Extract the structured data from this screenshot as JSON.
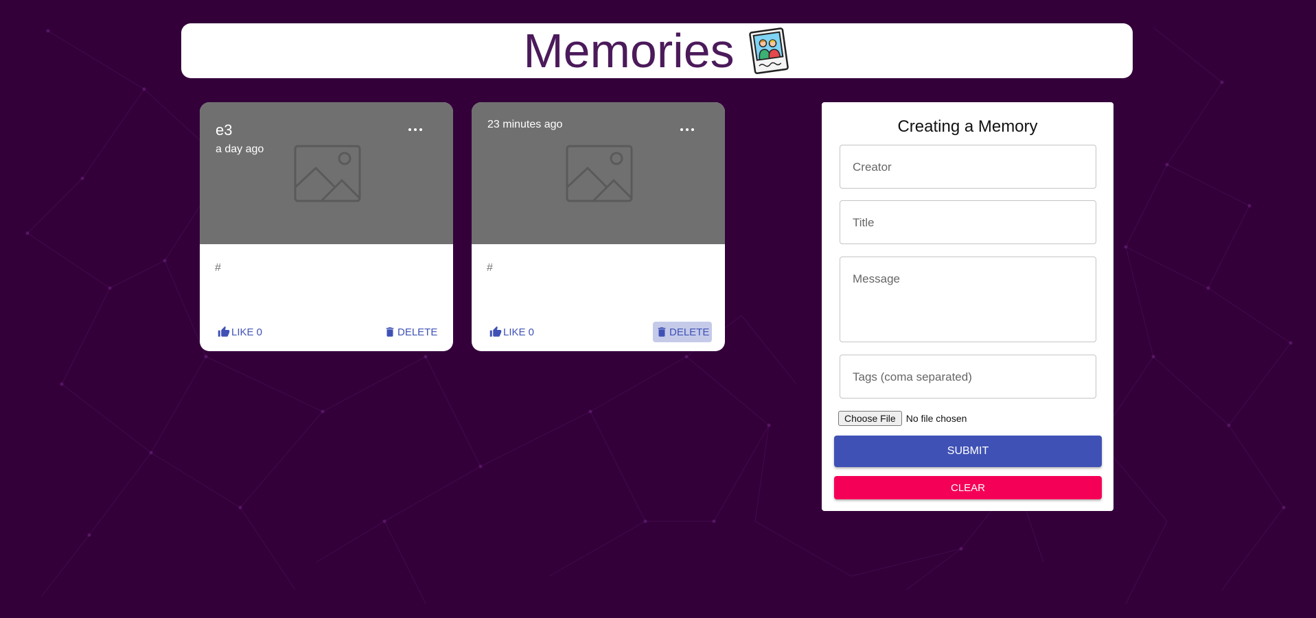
{
  "app": {
    "title": "Memories",
    "logo_icon": "photo-memories-icon"
  },
  "colors": {
    "background": "#33003a",
    "title": "#4b1a5a",
    "primary": "#3f51b5",
    "secondary": "#f50057",
    "card_media": "#707070"
  },
  "posts": [
    {
      "title": "e3",
      "time": "a day ago",
      "tags": "#",
      "like_label": "LIKE 0",
      "delete_label": "DELETE"
    },
    {
      "title": "",
      "time": "23 minutes ago",
      "tags": "#",
      "like_label": "LIKE 0",
      "delete_label": "DELETE"
    }
  ],
  "form": {
    "heading": "Creating a Memory",
    "creator_placeholder": "Creator",
    "title_placeholder": "Title",
    "message_placeholder": "Message",
    "tags_placeholder": "Tags (coma separated)",
    "file_button": "Choose File",
    "file_status": "No file chosen",
    "submit_label": "SUBMIT",
    "clear_label": "CLEAR"
  }
}
